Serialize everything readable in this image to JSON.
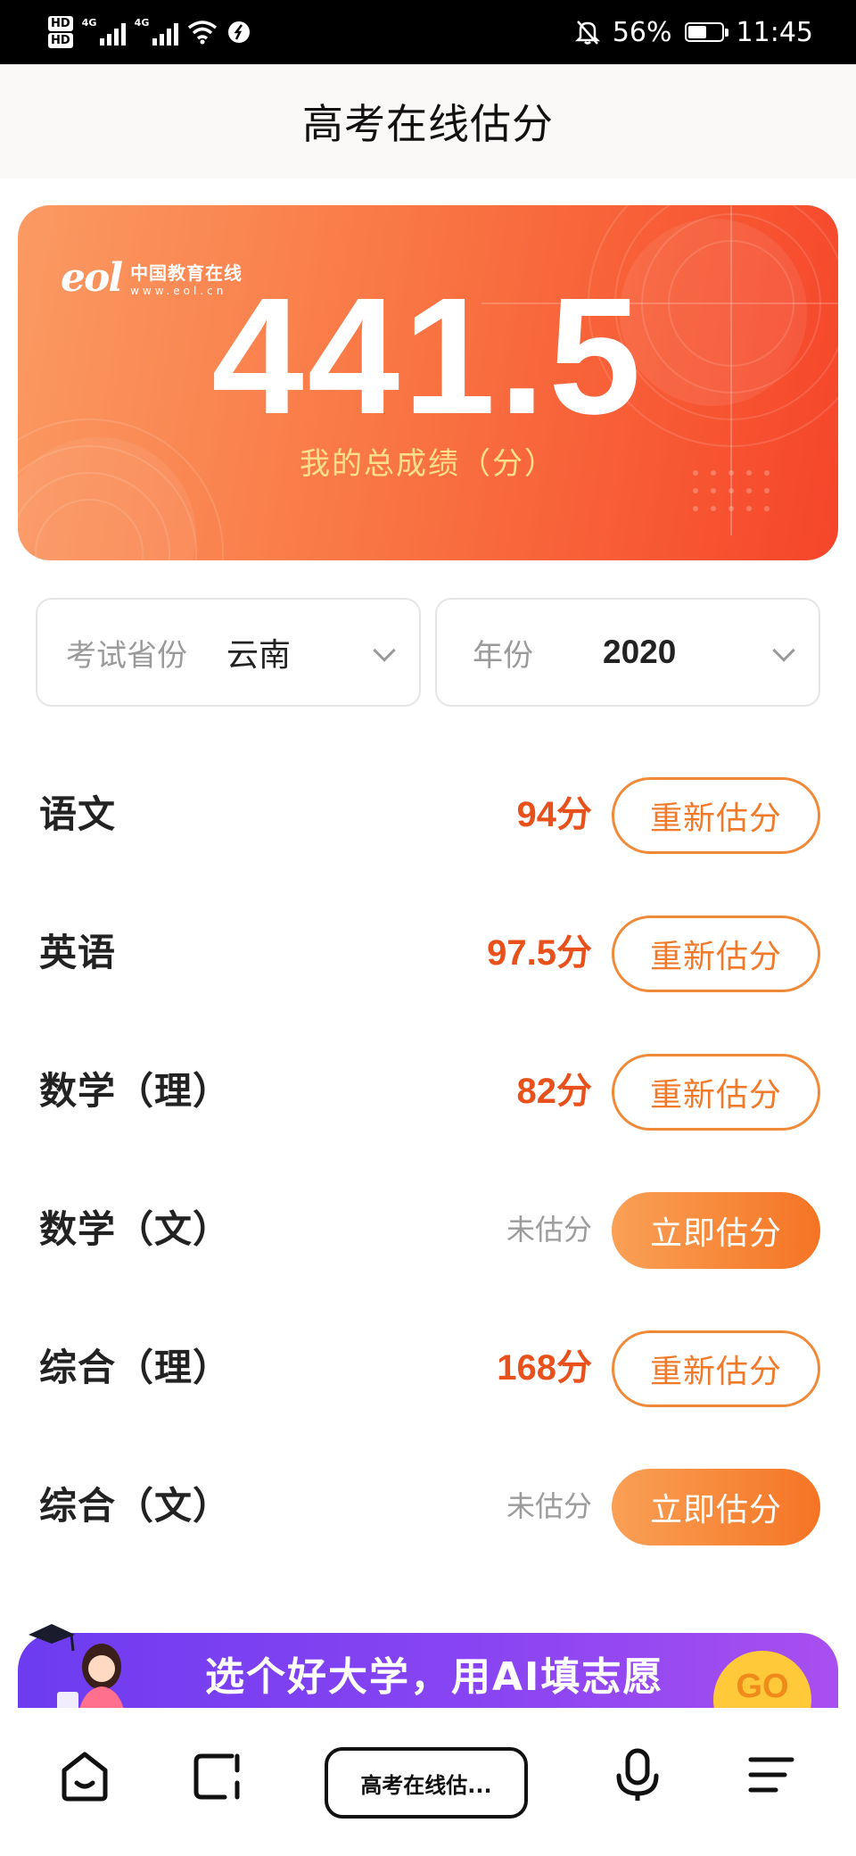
{
  "status_bar": {
    "hd1": "HD",
    "hd2": "HD",
    "net1": "4G",
    "net2": "4G",
    "battery_percent": "56%",
    "battery_level": 0.56,
    "time": "11:45",
    "icons": [
      "wifi-icon",
      "bell-off-icon",
      "battery-icon"
    ]
  },
  "header": {
    "title": "高考在线估分"
  },
  "score_card": {
    "logo_mark": "eol",
    "logo_cn": "中国教育在线",
    "logo_url": "www.eol.cn",
    "total_score": "441.5",
    "caption": "我的总成绩（分）"
  },
  "filters": {
    "province": {
      "label": "考试省份",
      "value": "云南"
    },
    "year": {
      "label": "年份",
      "value": "2020"
    }
  },
  "subjects": [
    {
      "name": "语文",
      "score": "94分",
      "estimated": true,
      "action": "重新估分"
    },
    {
      "name": "英语",
      "score": "97.5分",
      "estimated": true,
      "action": "重新估分"
    },
    {
      "name": "数学（理）",
      "score": "82分",
      "estimated": true,
      "action": "重新估分"
    },
    {
      "name": "数学（文）",
      "score": "未估分",
      "estimated": false,
      "action": "立即估分"
    },
    {
      "name": "综合（理）",
      "score": "168分",
      "estimated": true,
      "action": "重新估分"
    },
    {
      "name": "综合（文）",
      "score": "未估分",
      "estimated": false,
      "action": "立即估分"
    }
  ],
  "banner": {
    "text": "选个好大学，用AI填志愿",
    "go_label": "GO"
  },
  "bottom_nav": {
    "current_tab_label": "高考在线估...",
    "icons": [
      "home-icon",
      "tabs-icon",
      "microphone-icon",
      "menu-icon"
    ]
  },
  "colors": {
    "accent": "#f57424",
    "score_red": "#e8501c",
    "card_gradient_start": "#fb9a63",
    "card_gradient_end": "#f6452a",
    "banner_purple": "#7a40f1"
  }
}
